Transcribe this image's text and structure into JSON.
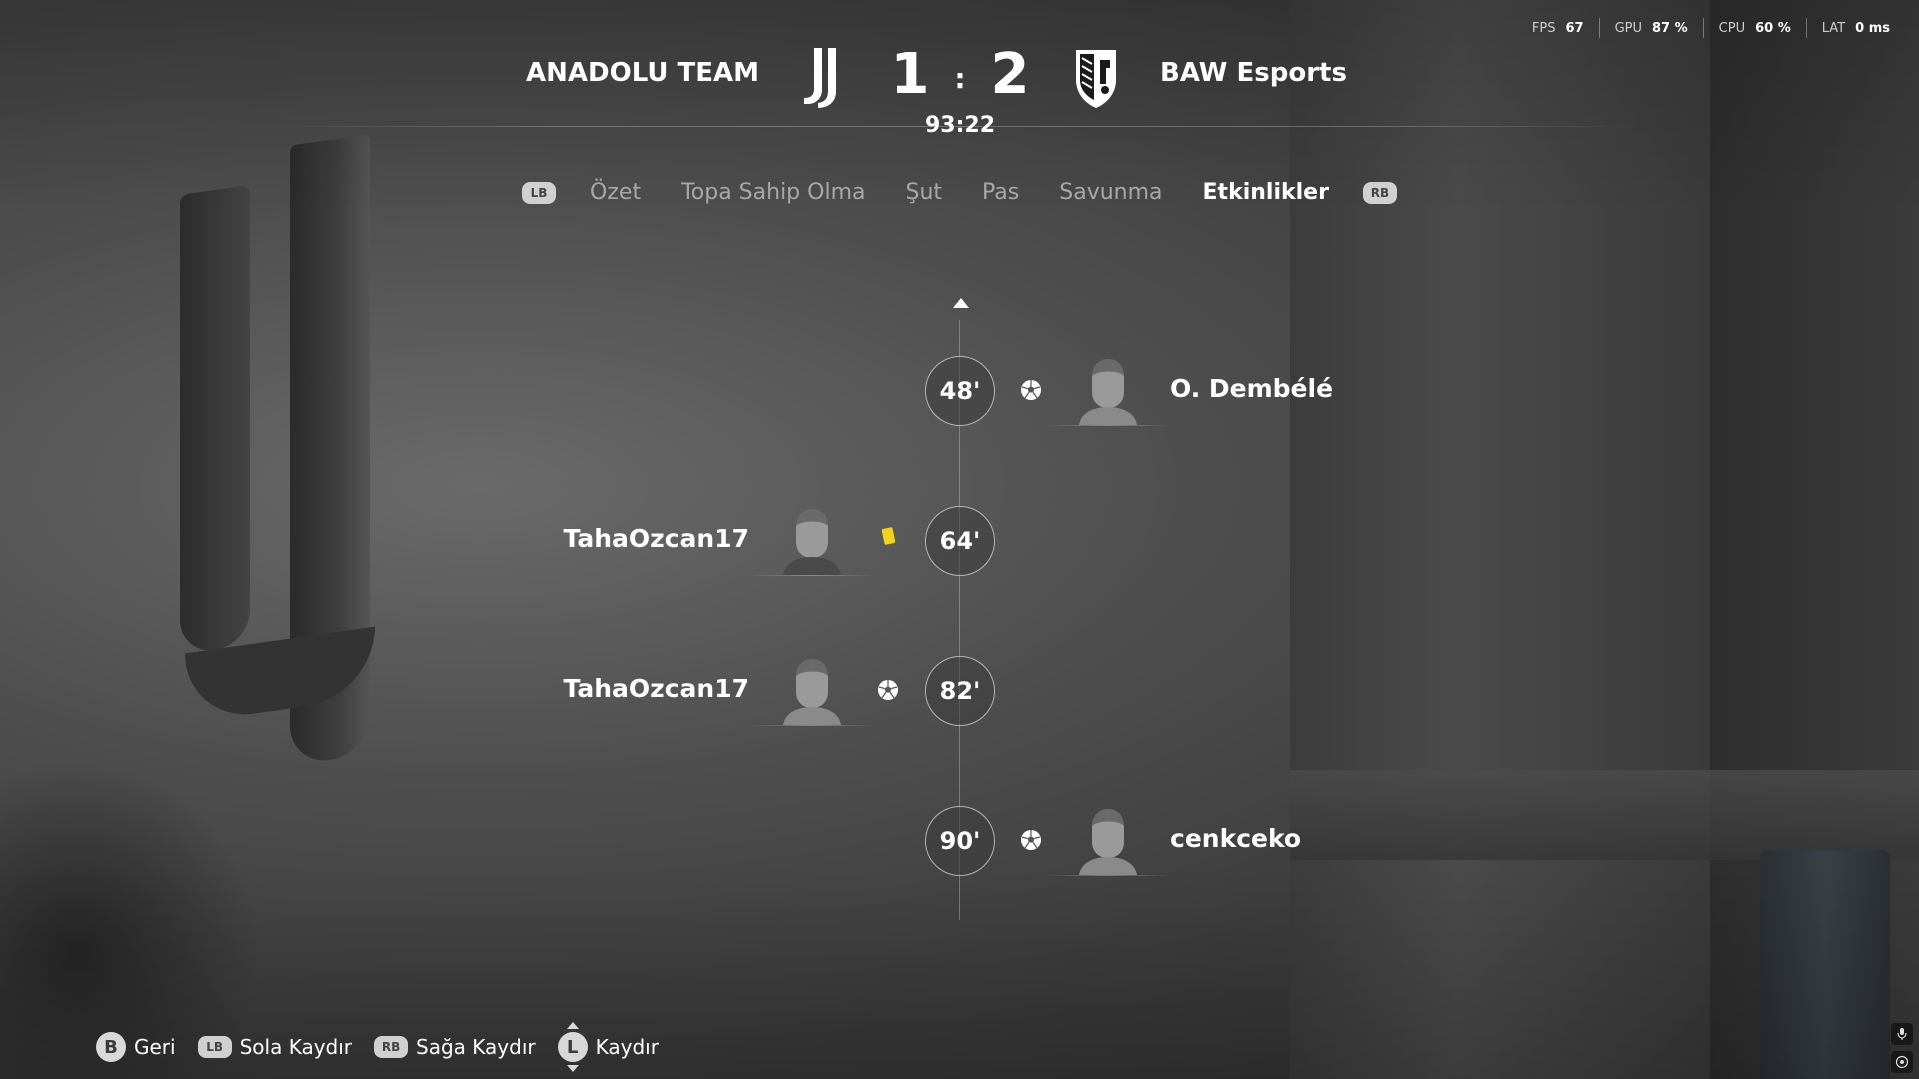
{
  "performance": {
    "fps_label": "FPS",
    "fps_value": "67",
    "gpu_label": "GPU",
    "gpu_value": "87 %",
    "cpu_label": "CPU",
    "cpu_value": "60 %",
    "lat_label": "LAT",
    "lat_value": "0 ms"
  },
  "scoreboard": {
    "home_team": "ANADOLU TEAM",
    "away_team": "BAW Esports",
    "home_score": "1",
    "away_score": "2",
    "separator": ":",
    "clock": "93:22",
    "home_crest_icon": "juventus-crest-icon",
    "away_crest_icon": "guimaraes-crest-icon"
  },
  "tabs": {
    "prev_bumper": "LB",
    "next_bumper": "RB",
    "items": [
      {
        "label": "Özet",
        "active": false
      },
      {
        "label": "Topa Sahip Olma",
        "active": false
      },
      {
        "label": "Şut",
        "active": false
      },
      {
        "label": "Pas",
        "active": false
      },
      {
        "label": "Savunma",
        "active": false
      },
      {
        "label": "Etkinlikler",
        "active": true
      }
    ]
  },
  "events": [
    {
      "minute": "48'",
      "side": "away",
      "type": "goal",
      "player": "O. Dembélé",
      "icon": "football-icon"
    },
    {
      "minute": "64'",
      "side": "home",
      "type": "yellow-card",
      "player": "TahaOzcan17",
      "icon": "yellow-card-icon",
      "card_color": "#f2d21b"
    },
    {
      "minute": "82'",
      "side": "home",
      "type": "goal",
      "player": "TahaOzcan17",
      "icon": "football-icon"
    },
    {
      "minute": "90'",
      "side": "away",
      "type": "goal",
      "player": "cenkceko",
      "icon": "football-icon"
    }
  ],
  "footer": {
    "back_button": "B",
    "back_label": "Geri",
    "left_button": "LB",
    "left_label": "Sola Kaydır",
    "right_button": "RB",
    "right_label": "Sağa Kaydır",
    "scroll_button": "L",
    "scroll_label": "Kaydır"
  }
}
